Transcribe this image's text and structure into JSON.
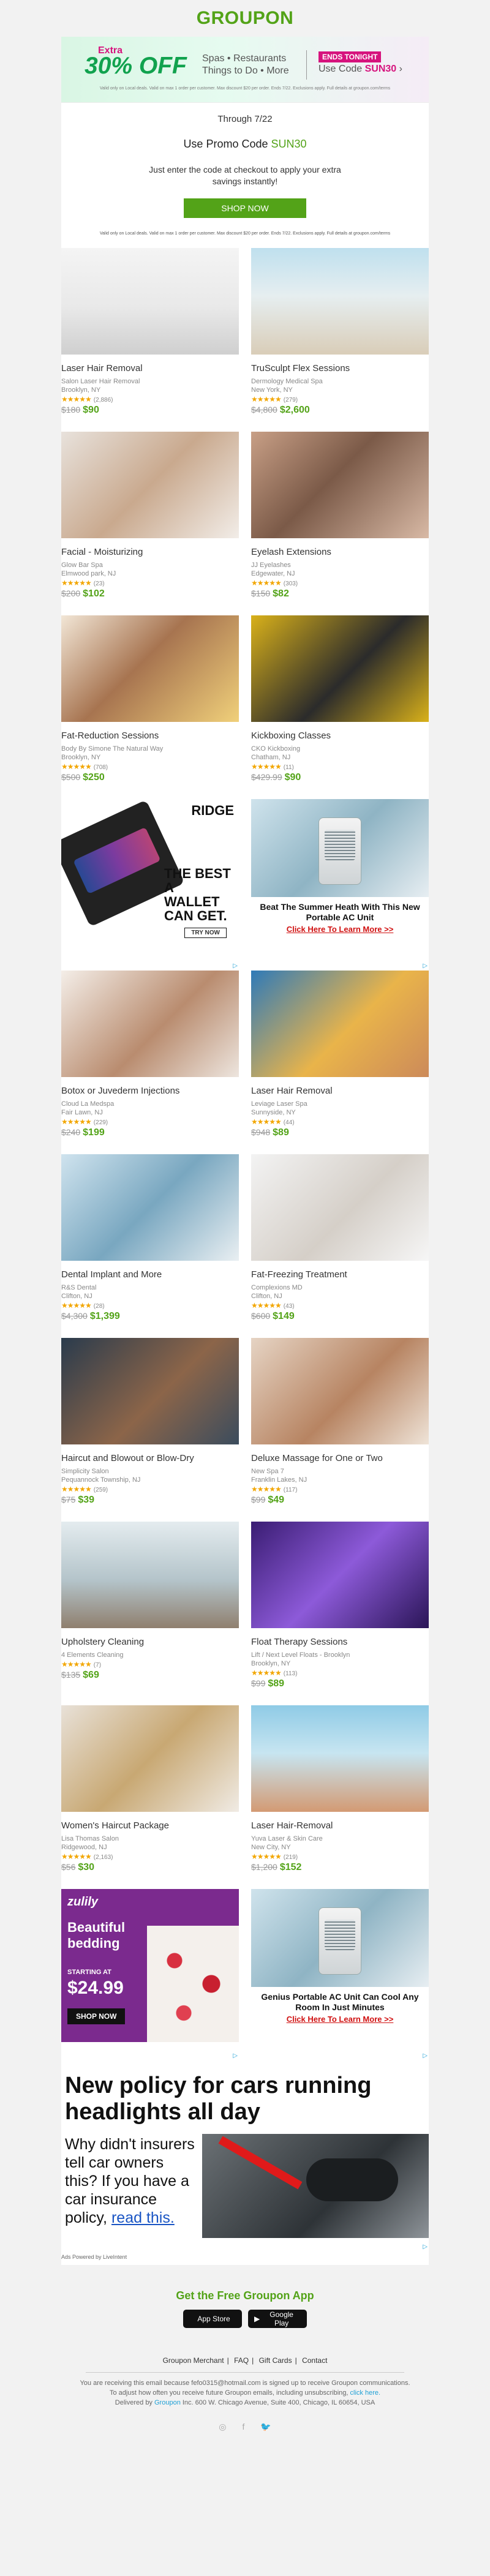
{
  "header": {
    "logo": "GROUPON"
  },
  "banner": {
    "extra": "Extra",
    "off": "30% OFF",
    "sub_line1": "Spas • Restaurants",
    "sub_line2": "Things to Do • More",
    "ends": "ENDS TONIGHT",
    "code_prefix": "Use Code",
    "code": "SUN30",
    "fine": "Valid only on Local deals. Valid on max 1 order per customer. Max discount $20 per order. Ends 7/22. Exclusions apply. Full details at groupon.com/terms"
  },
  "promo": {
    "through": "Through 7/22",
    "line_prefix": "Use Promo Code",
    "code": "SUN30",
    "text": "Just enter the code at checkout to apply your extra savings instantly!",
    "button": "SHOP NOW",
    "fine": "Valid only on Local deals. Valid on max 1 order per customer. Max discount $20 per order. Ends 7/22. Exclusions apply. Full details at groupon.com/terms"
  },
  "deals": [
    {
      "title": "Laser Hair Removal",
      "merchant": "Salon Laser Hair Removal",
      "loc": "Brooklyn, NY",
      "stars": "★★★★★",
      "count": "(2,886)",
      "old": "$180",
      "new": "$90",
      "img": "spa-room"
    },
    {
      "title": "TruSculpt Flex Sessions",
      "merchant": "Dermology Medical Spa",
      "loc": "New York, NY",
      "stars": "★★★★★",
      "count": "(279)",
      "old": "$4,800",
      "new": "$2,600",
      "img": "beach-body"
    },
    {
      "title": "Facial - Moisturizing",
      "merchant": "Glow Bar Spa",
      "loc": "Elmwood park, NJ",
      "stars": "★★★★★",
      "count": "(23)",
      "old": "$200",
      "new": "$102",
      "img": "facial"
    },
    {
      "title": "Eyelash Extensions",
      "merchant": "JJ Eyelashes",
      "loc": "Edgewater, NJ",
      "stars": "★★★★★",
      "count": "(303)",
      "old": "$150",
      "new": "$82",
      "img": "eyelash"
    },
    {
      "title": "Fat-Reduction Sessions",
      "merchant": "Body By Simone The Natural Way",
      "loc": "Brooklyn, NY",
      "stars": "★★★★★",
      "count": "(708)",
      "old": "$500",
      "new": "$250",
      "img": "fitness"
    },
    {
      "title": "Kickboxing Classes",
      "merchant": "CKO Kickboxing",
      "loc": "Chatham, NJ",
      "stars": "★★★★★",
      "count": "(11)",
      "old": "$429.99",
      "new": "$90",
      "img": "kickboxing"
    },
    {
      "title": "Botox or Juvederm Injections",
      "merchant": "Cloud La Medspa",
      "loc": "Fair Lawn, NJ",
      "stars": "★★★★★",
      "count": "(229)",
      "old": "$240",
      "new": "$199",
      "img": "botox"
    },
    {
      "title": "Laser Hair Removal",
      "merchant": "Leviage Laser Spa",
      "loc": "Sunnyside, NY",
      "stars": "★★★★★",
      "count": "(44)",
      "old": "$948",
      "new": "$89",
      "img": "legs"
    },
    {
      "title": "Dental Implant and More",
      "merchant": "R&S Dental",
      "loc": "Clifton, NJ",
      "stars": "★★★★★",
      "count": "(28)",
      "old": "$4,300",
      "new": "$1,399",
      "img": "dental"
    },
    {
      "title": "Fat-Freezing Treatment",
      "merchant": "Complexions MD",
      "loc": "Clifton, NJ",
      "stars": "★★★★★",
      "count": "(43)",
      "old": "$600",
      "new": "$149",
      "img": "freezing"
    },
    {
      "title": "Haircut and Blowout or Blow-Dry",
      "merchant": "Simplicity Salon",
      "loc": "Pequannock Township, NJ",
      "stars": "★★★★★",
      "count": "(259)",
      "old": "$75",
      "new": "$39",
      "img": "hair"
    },
    {
      "title": "Deluxe Massage for One or Two",
      "merchant": "New Spa 7",
      "loc": "Franklin Lakes, NJ",
      "stars": "★★★★★",
      "count": "(117)",
      "old": "$99",
      "new": "$49",
      "img": "massage"
    },
    {
      "title": "Upholstery Cleaning",
      "merchant": "4 Elements Cleaning",
      "loc": "",
      "stars": "★★★★★",
      "count": "(7)",
      "old": "$135",
      "new": "$69",
      "img": "sofa"
    },
    {
      "title": "Float Therapy Sessions",
      "merchant": "Lift / Next Level Floats - Brooklyn",
      "loc": "Brooklyn, NY",
      "stars": "★★★★★",
      "count": "(113)",
      "old": "$99",
      "new": "$89",
      "img": "float"
    },
    {
      "title": "Women's Haircut Package",
      "merchant": "Lisa Thomas Salon",
      "loc": "Ridgewood, NJ",
      "stars": "★★★★★",
      "count": "(2,163)",
      "old": "$56",
      "new": "$30",
      "img": "blonde"
    },
    {
      "title": "Laser Hair-Removal",
      "merchant": "Yuva Laser & Skin Care",
      "loc": "New City, NY",
      "stars": "★★★★★",
      "count": "(219)",
      "old": "$1,200",
      "new": "$152",
      "img": "beach-girl"
    }
  ],
  "ads": {
    "wallet_brand": "RIDGE",
    "wallet_text": "THE BEST A WALLET CAN GET.",
    "wallet_btn": "TRY NOW",
    "fan1_head": "Beat The Summer Heath With This New Portable AC Unit",
    "fan1_link": "Click Here To Learn More >>",
    "zulily_logo": "zulily",
    "zulily_text": "Beautiful bedding",
    "zulily_start": "STARTING AT",
    "zulily_price": "$24.99",
    "zulily_btn": "SHOP NOW",
    "fan2_head": "Genius Portable AC Unit Can Cool Any Room In Just Minutes",
    "fan2_link": "Click Here To Learn More >>",
    "big_headline": "New policy for cars running headlights all day",
    "big_body": "Why didn't insurers tell car owners this? If you have a car insurance policy,",
    "big_link": "read this.",
    "ads_by": "Ads Powered by LiveIntent"
  },
  "app": {
    "title": "Get the Free Groupon App",
    "appstore": "App Store",
    "googleplay": "Google Play"
  },
  "footer": {
    "links": [
      "Groupon Merchant",
      "FAQ",
      "Gift Cards",
      "Contact"
    ],
    "line1": "You are receiving this email because fefo0315@hotmail.com is signed up to receive Groupon communications.",
    "line2": "To adjust how often you receive future Groupon emails, including unsubscribing,",
    "click": "click here.",
    "line3": "Delivered by",
    "groupon": "Groupon",
    "addr": "Inc. 600 W. Chicago Avenue, Suite 400, Chicago, IL 60654, USA",
    "social": [
      "instagram-icon",
      "facebook-icon",
      "twitter-icon"
    ]
  }
}
